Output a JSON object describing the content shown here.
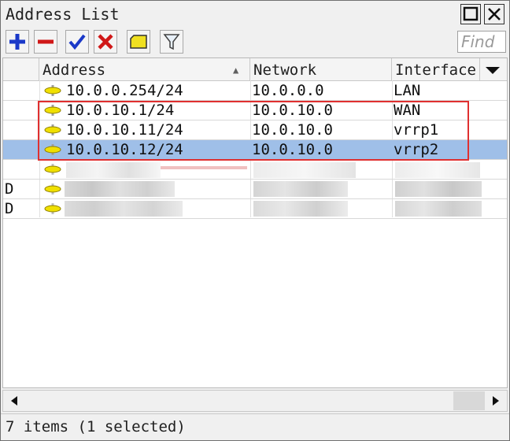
{
  "window": {
    "title": "Address List"
  },
  "toolbar": {
    "find_placeholder": "Find"
  },
  "columns": [
    "Address",
    "Network",
    "Interface"
  ],
  "rows": [
    {
      "flag": "",
      "address": "10.0.0.254/24",
      "network": "10.0.0.0",
      "interface": "LAN",
      "selected": false
    },
    {
      "flag": "",
      "address": "10.0.10.1/24",
      "network": "10.0.10.0",
      "interface": "WAN",
      "selected": false
    },
    {
      "flag": "",
      "address": "10.0.10.11/24",
      "network": "10.0.10.0",
      "interface": "vrrp1",
      "selected": false
    },
    {
      "flag": "",
      "address": "10.0.10.12/24",
      "network": "10.0.10.0",
      "interface": "vrrp2",
      "selected": true
    },
    {
      "flag": "",
      "address": "",
      "network": "",
      "interface": "",
      "selected": false
    },
    {
      "flag": "D",
      "address": "",
      "network": "",
      "interface": "",
      "selected": false
    },
    {
      "flag": "D",
      "address": "",
      "network": "",
      "interface": "",
      "selected": false
    }
  ],
  "status": {
    "text": "7 items (1 selected)"
  }
}
